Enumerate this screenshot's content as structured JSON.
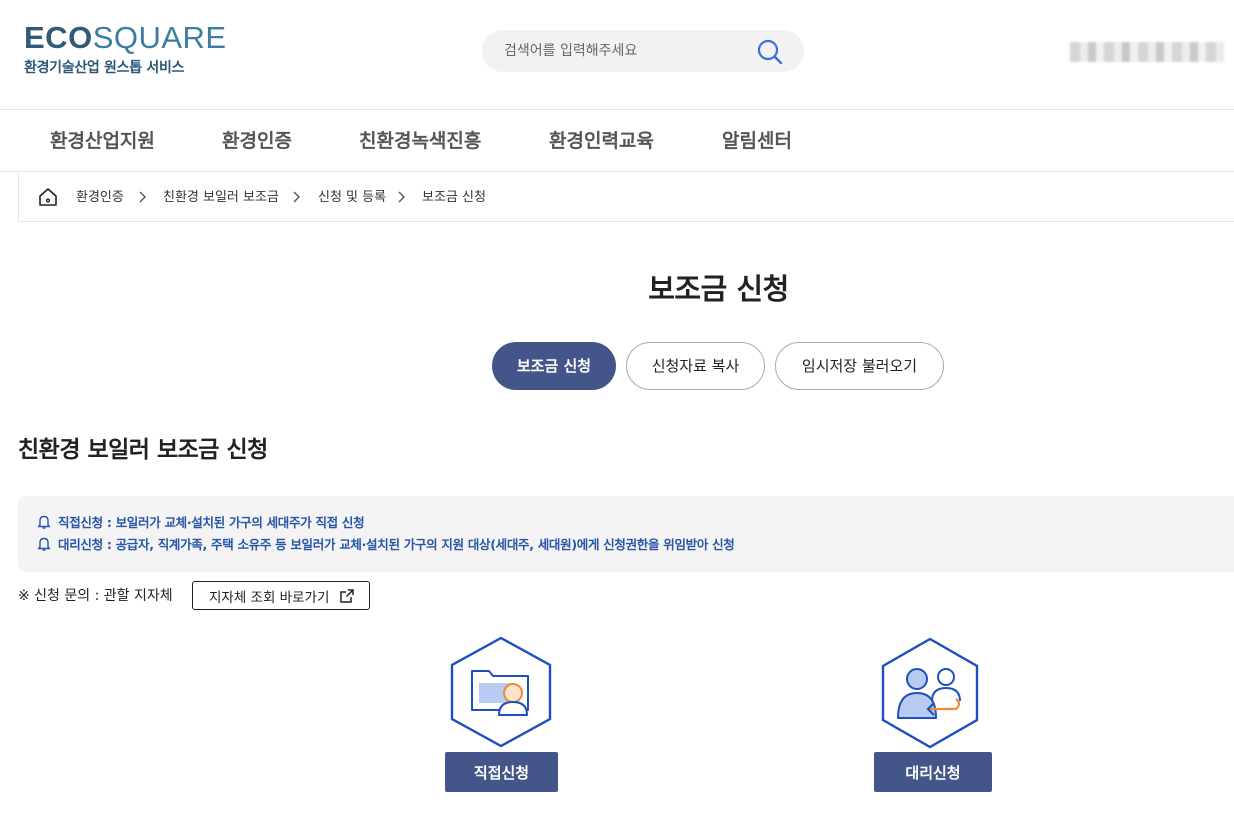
{
  "header": {
    "logo_eco": "ECO",
    "logo_square": "SQUARE",
    "logo_subtitle": "환경기술산업 원스톱 서비스",
    "search_placeholder": "검색어를 입력해주세요"
  },
  "gnb": {
    "items": [
      "환경산업지원",
      "환경인증",
      "친환경녹색진흥",
      "환경인력교육",
      "알림센터"
    ]
  },
  "breadcrumb": {
    "items": [
      "환경인증",
      "친환경 보일러 보조금",
      "신청 및 등록",
      "보조금 신청"
    ]
  },
  "page": {
    "title": "보조금 신청",
    "tabs": [
      {
        "label": "보조금 신청",
        "active": true
      },
      {
        "label": "신청자료 복사",
        "active": false
      },
      {
        "label": "임시저장 불러오기",
        "active": false
      }
    ],
    "section_title": "친환경 보일러 보조금 신청",
    "notices": [
      "직접신청 : 보일러가 교체·설치된 가구의 세대주가 직접 신청",
      "대리신청 : 공급자, 직계가족, 주택 소유주 등 보일러가 교체·설치된 가구의 지원 대상(세대주, 세대원)에게 신청권한을 위임받아 신청"
    ],
    "inquiry_text": "※ 신청 문의 : 관할 지자체",
    "inquiry_button": "지자체 조회 바로가기",
    "direct_apply": "직접신청",
    "proxy_apply": "대리신청"
  },
  "colors": {
    "primary": "#435589",
    "notice_text": "#2755a7",
    "hex_border": "#1e4fbf",
    "accent_orange": "#f08a36"
  }
}
